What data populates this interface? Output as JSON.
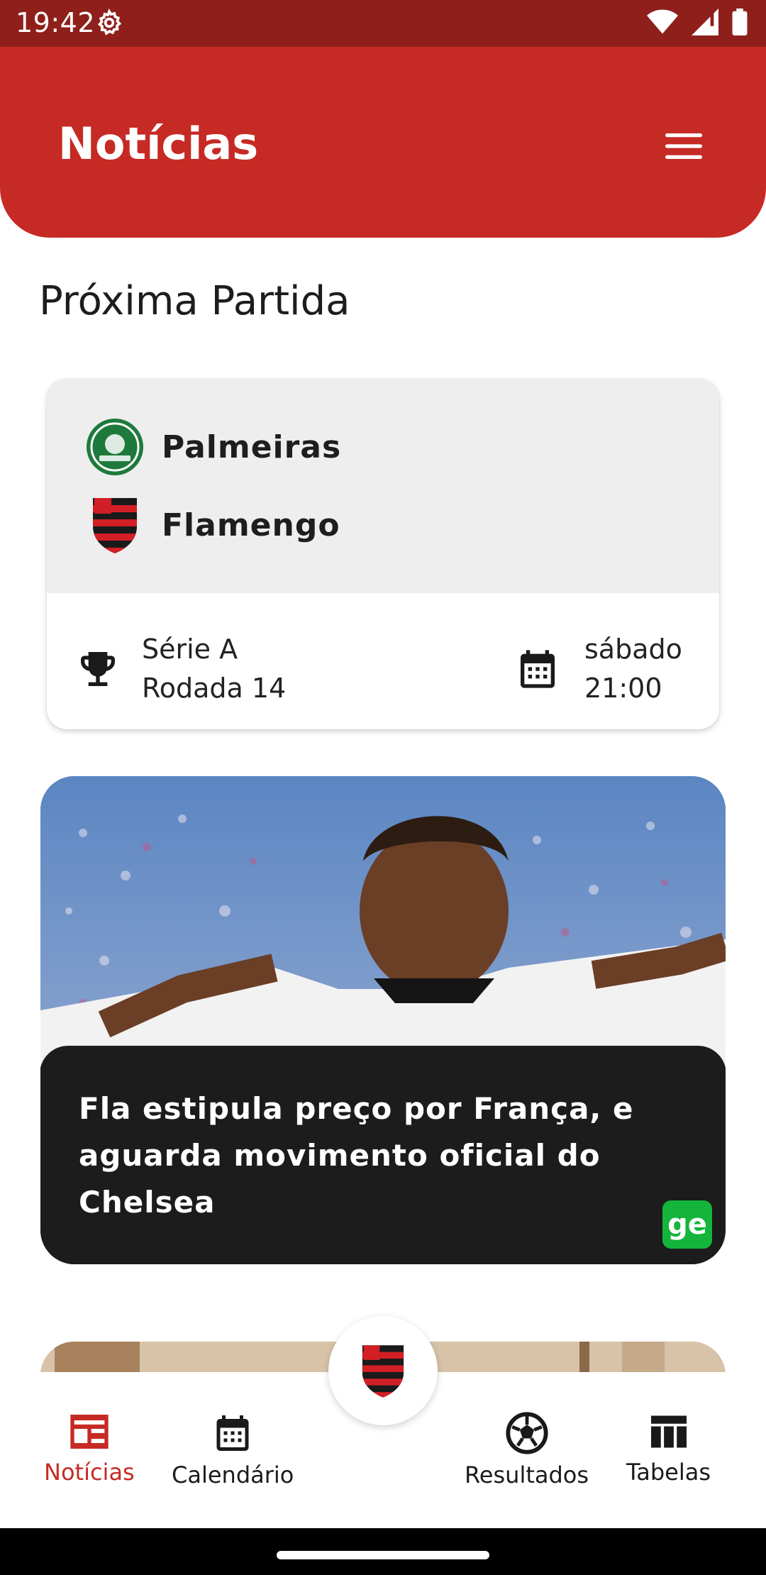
{
  "status_bar": {
    "time": "19:42"
  },
  "header": {
    "title": "Notícias"
  },
  "next_match": {
    "section_title": "Próxima Partida",
    "home_team": "Palmeiras",
    "away_team": "Flamengo",
    "competition": "Série A",
    "round": "Rodada 14",
    "day": "sábado",
    "time": "21:00"
  },
  "news": [
    {
      "title": "Fla estipula preço por França, e aguarda movimento oficial do Chelsea",
      "source_badge": "ge"
    }
  ],
  "bottom_nav": {
    "items": [
      {
        "label": "Notícias",
        "icon": "newspaper-icon",
        "active": true
      },
      {
        "label": "Calendário",
        "icon": "calendar-icon",
        "active": false
      },
      {
        "label": "Resultados",
        "icon": "soccer-ball-icon",
        "active": false
      },
      {
        "label": "Tabelas",
        "icon": "table-icon",
        "active": false
      }
    ]
  },
  "colors": {
    "primary": "#c62a24",
    "status_bar": "#8e1f1b",
    "source_badge": "#14b53a"
  }
}
